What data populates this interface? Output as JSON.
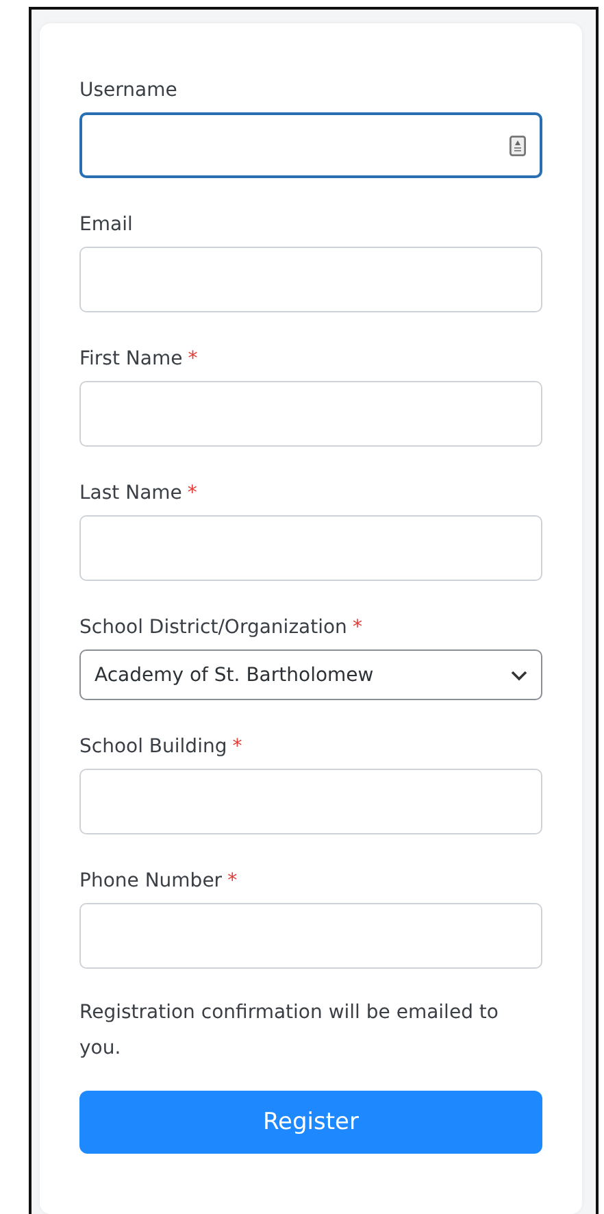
{
  "fields": [
    {
      "kind": "text",
      "label": "Username",
      "focused": true,
      "icon": true
    },
    {
      "kind": "text",
      "label": "Email",
      "focused": false
    },
    {
      "kind": "text",
      "label": "First Name",
      "required_mark": "*",
      "focused": false
    },
    {
      "kind": "text",
      "label": "Last Name",
      "required_mark": "*",
      "focused": false
    },
    {
      "kind": "select",
      "label": "School District/Organization",
      "required_mark": "*",
      "value": "Academy of St. Bartholomew",
      "focused": false
    },
    {
      "kind": "text",
      "label": "School Building",
      "required_mark": "*",
      "focused": false
    },
    {
      "kind": "text",
      "label": "Phone Number",
      "required_mark": "*",
      "focused": false
    }
  ],
  "note": "Registration confirmation will be emailed to you.",
  "submit": "Register"
}
